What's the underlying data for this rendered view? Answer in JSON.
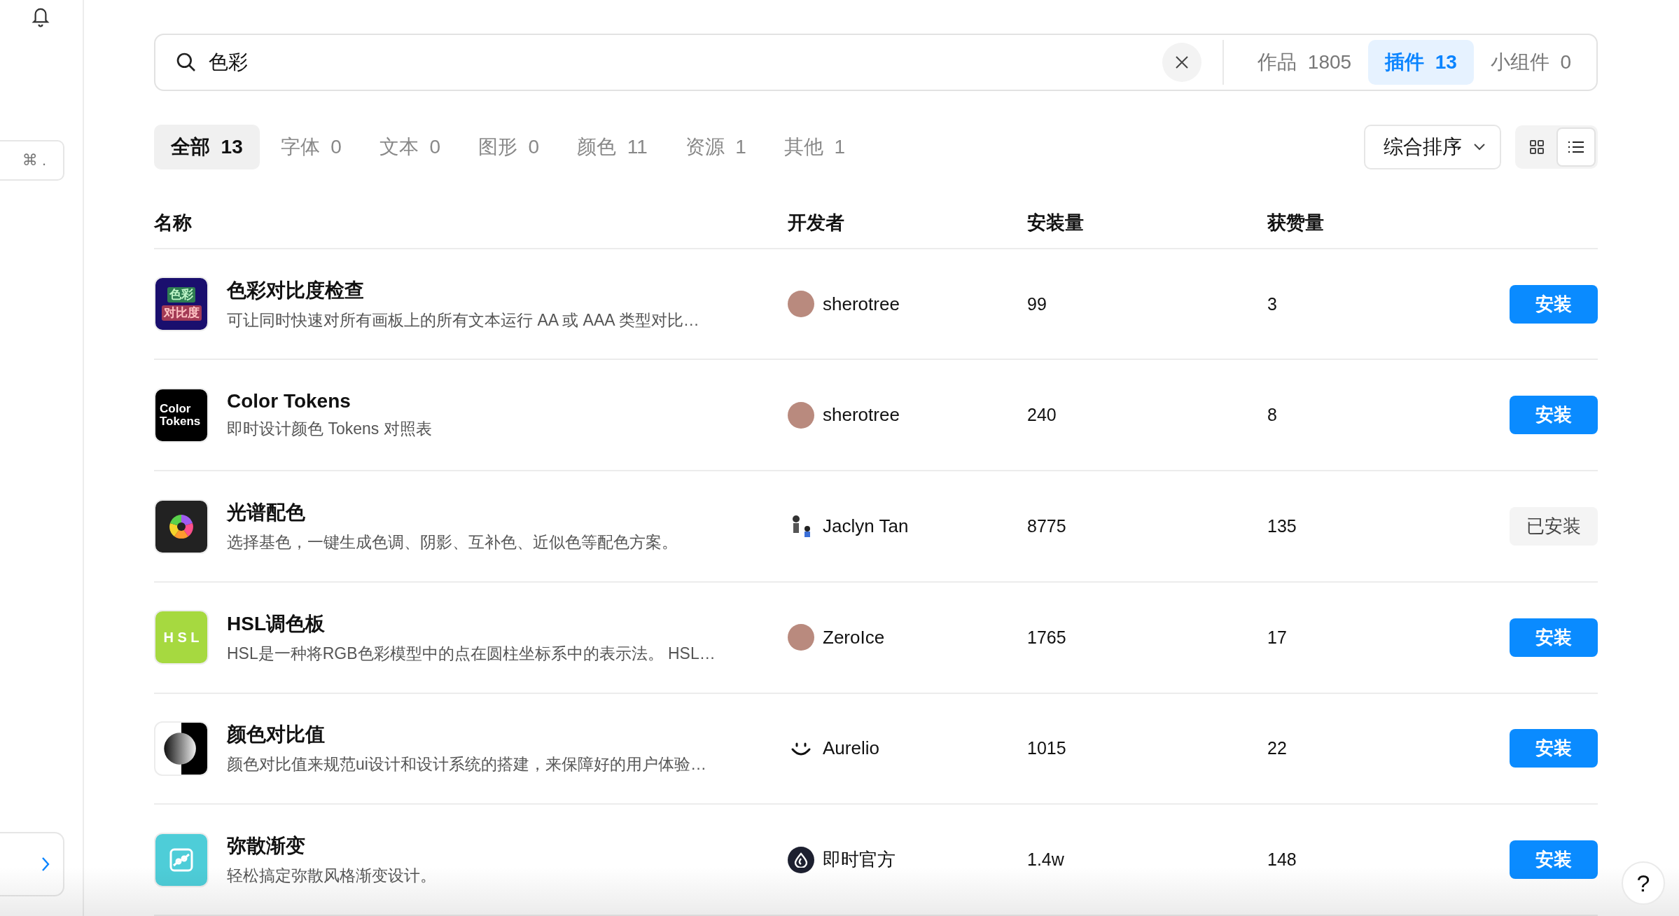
{
  "sidebar": {
    "shortcut": "⌘ ."
  },
  "search": {
    "value": "色彩"
  },
  "scopes": [
    {
      "label": "作品",
      "count": "1805",
      "selected": false
    },
    {
      "label": "插件",
      "count": "13",
      "selected": true
    },
    {
      "label": "小组件",
      "count": "0",
      "selected": false
    }
  ],
  "categories": [
    {
      "label": "全部",
      "count": "13",
      "selected": true
    },
    {
      "label": "字体",
      "count": "0",
      "selected": false
    },
    {
      "label": "文本",
      "count": "0",
      "selected": false
    },
    {
      "label": "图形",
      "count": "0",
      "selected": false
    },
    {
      "label": "颜色",
      "count": "11",
      "selected": false
    },
    {
      "label": "资源",
      "count": "1",
      "selected": false
    },
    {
      "label": "其他",
      "count": "1",
      "selected": false
    }
  ],
  "sort": {
    "label": "综合排序"
  },
  "view_modes": [
    {
      "kind": "grid",
      "selected": false
    },
    {
      "kind": "list",
      "selected": true
    }
  ],
  "table": {
    "columns": [
      "名称",
      "开发者",
      "安装量",
      "获赞量"
    ],
    "rows": [
      {
        "icon": {
          "kind": "text-tiles",
          "lines": [
            "色彩",
            "对比度"
          ]
        },
        "name": "色彩对比度检查",
        "description": "可让同时快速对所有画板上的所有文本运行 AA 或 AAA 类型对比…",
        "developer": "sherotree",
        "avatar": {
          "kind": "photo"
        },
        "installs": "99",
        "likes": "3",
        "installed": false,
        "action": "安装"
      },
      {
        "icon": {
          "kind": "text-dark",
          "lines": [
            "Color",
            "Tokens"
          ]
        },
        "name": "Color Tokens",
        "description": "即时设计颜色 Tokens 对照表",
        "developer": "sherotree",
        "avatar": {
          "kind": "photo"
        },
        "installs": "240",
        "likes": "8",
        "installed": false,
        "action": "安装"
      },
      {
        "icon": {
          "kind": "color-wheel"
        },
        "name": "光谱配色",
        "description": "选择基色，一键生成色调、阴影、互补色、近似色等配色方案。",
        "developer": "Jaclyn Tan",
        "avatar": {
          "kind": "figures"
        },
        "installs": "8775",
        "likes": "135",
        "installed": true,
        "action": "已安装"
      },
      {
        "icon": {
          "kind": "text-green",
          "lines": [
            "H S L"
          ]
        },
        "name": "HSL调色板",
        "description": "HSL是一种将RGB色彩模型中的点在圆柱坐标系中的表示法。 HSL…",
        "developer": "ZeroIce",
        "avatar": {
          "kind": "photo"
        },
        "installs": "1765",
        "likes": "17",
        "installed": false,
        "action": "安装"
      },
      {
        "icon": {
          "kind": "contrast"
        },
        "name": "颜色对比值",
        "description": "颜色对比值来规范ui设计和设计系统的搭建，来保障好的用户体验…",
        "developer": "Aurelio",
        "avatar": {
          "kind": "smile"
        },
        "installs": "1015",
        "likes": "22",
        "installed": false,
        "action": "安装"
      },
      {
        "icon": {
          "kind": "gradient"
        },
        "name": "弥散渐变",
        "description": "轻松搞定弥散风格渐变设计。",
        "developer": "即时官方",
        "avatar": {
          "kind": "drop"
        },
        "installs": "1.4w",
        "likes": "148",
        "installed": false,
        "action": "安装"
      }
    ]
  },
  "help": {
    "label": "?"
  }
}
